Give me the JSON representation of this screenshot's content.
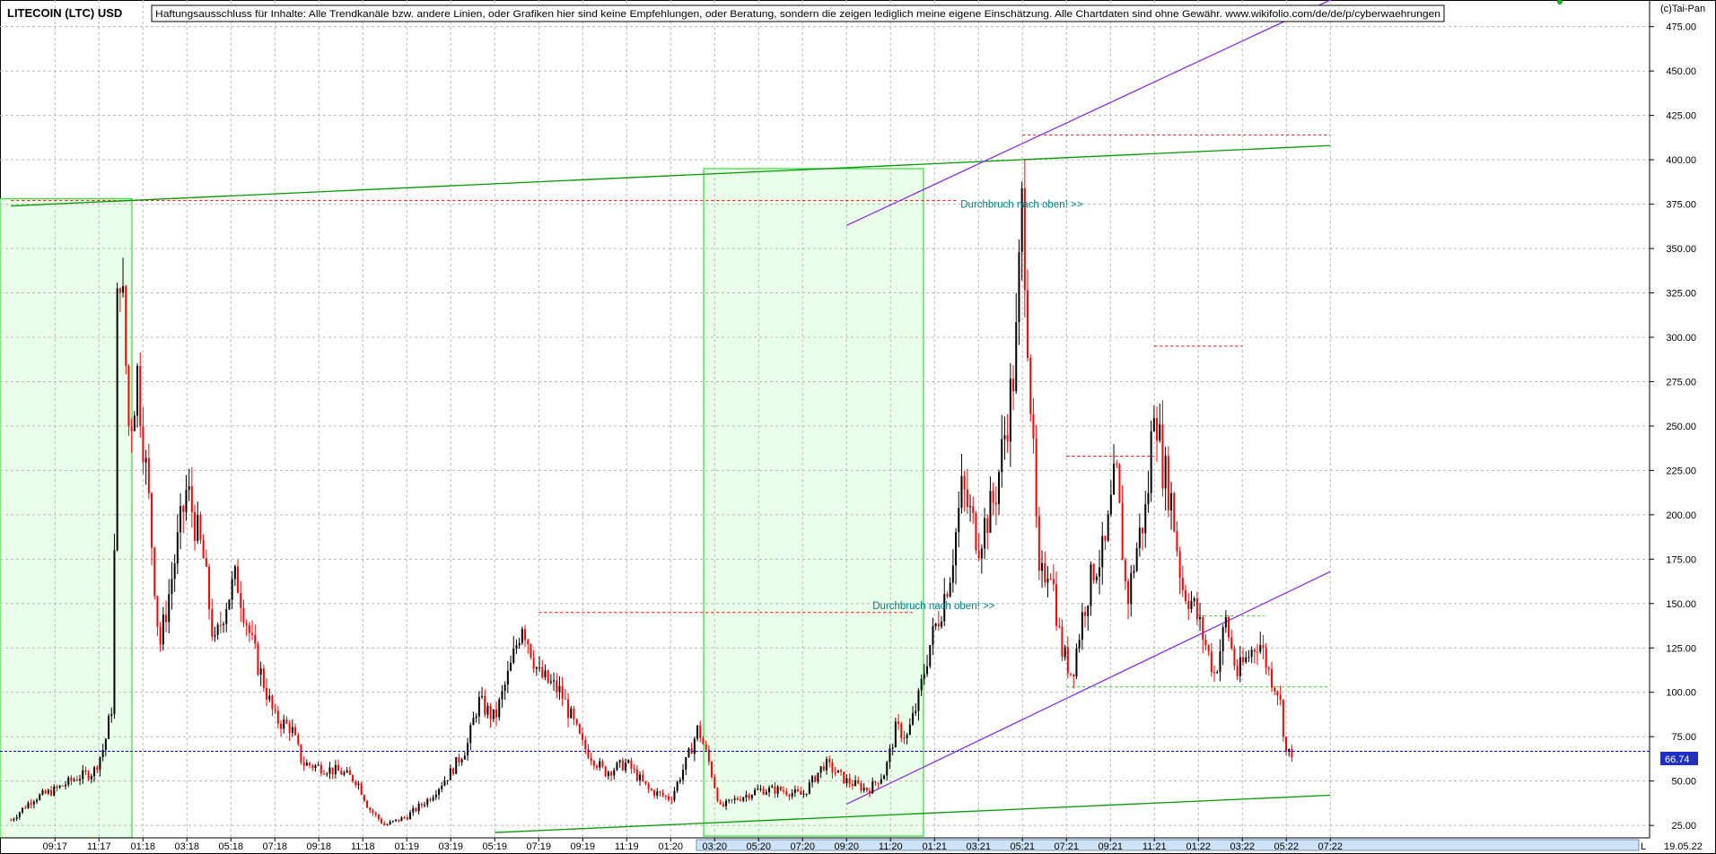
{
  "header": {
    "title": "LITECOIN (LTC) USD",
    "disclaimer": "Haftungsausschluss für Inhalte: Alle Trendkanäle bzw. andere Linien, oder Grafiken hier sind keine Empfehlungen, oder Beratung, sondern die zeigen lediglich meine eigene Einschätzung. Alle Chartdaten sind ohne Gewähr.  www.wikifolio.com/de/de/p/cyberwaehrungen",
    "copyright": "(c)Tai-Pan"
  },
  "colors": {
    "up_candle": "#000000",
    "down_candle": "#ff0000",
    "trend_green": "#009900",
    "trend_purple": "#8a2be2",
    "resistance_red": "#ff0000",
    "support_green": "#22cc22",
    "zone_fill": "#eaffea",
    "zone_border": "#33dd33",
    "last_price_line": "#0000cc",
    "annotation": "#008080"
  },
  "chart_data": {
    "type": "candlestick",
    "title": "LITECOIN (LTC) USD",
    "y_axis": {
      "ticks": [
        25,
        50,
        75,
        100,
        125,
        150,
        175,
        200,
        225,
        250,
        275,
        300,
        325,
        350,
        375,
        400,
        425,
        450,
        475
      ],
      "ylim": [
        18,
        490
      ],
      "position": "right"
    },
    "x_axis": {
      "ticks": [
        "09:17",
        "11:17",
        "01:18",
        "03:18",
        "05:18",
        "07:18",
        "09:18",
        "11:18",
        "01:19",
        "03:19",
        "05:19",
        "07:19",
        "09:19",
        "11:19",
        "01:20",
        "03:20",
        "05:20",
        "07:20",
        "09:20",
        "11:20",
        "01:21",
        "03:21",
        "05:21",
        "07:21",
        "09:21",
        "11:21",
        "01:22",
        "03:22",
        "05:22",
        "07:22"
      ],
      "end_label": "19.05.22",
      "scale_letter": "L"
    },
    "grid": true,
    "last_price": {
      "value": 66.74,
      "label": "66.74"
    },
    "price_path": [
      [
        "07:17",
        28
      ],
      [
        "08:17",
        40
      ],
      [
        "09:17",
        45
      ],
      [
        "10:17",
        52
      ],
      [
        "11:17",
        55
      ],
      [
        "11:17",
        70
      ],
      [
        "12:17",
        95
      ],
      [
        "12:17",
        360
      ],
      [
        "12:17",
        310
      ],
      [
        "12:17",
        245
      ],
      [
        "01:18",
        280
      ],
      [
        "01:18",
        210
      ],
      [
        "02:18",
        125
      ],
      [
        "02:18",
        160
      ],
      [
        "03:18",
        215
      ],
      [
        "04:18",
        175
      ],
      [
        "04:18",
        125
      ],
      [
        "05:18",
        150
      ],
      [
        "05:18",
        165
      ],
      [
        "06:18",
        125
      ],
      [
        "07:18",
        85
      ],
      [
        "08:18",
        80
      ],
      [
        "08:18",
        60
      ],
      [
        "09:18",
        58
      ],
      [
        "10:18",
        55
      ],
      [
        "11:18",
        50
      ],
      [
        "11:18",
        35
      ],
      [
        "12:18",
        25
      ],
      [
        "01:19",
        30
      ],
      [
        "02:19",
        40
      ],
      [
        "03:19",
        55
      ],
      [
        "04:19",
        70
      ],
      [
        "04:19",
        95
      ],
      [
        "05:19",
        85
      ],
      [
        "06:19",
        115
      ],
      [
        "06:19",
        140
      ],
      [
        "07:19",
        110
      ],
      [
        "08:19",
        100
      ],
      [
        "09:19",
        70
      ],
      [
        "10:19",
        55
      ],
      [
        "11:19",
        60
      ],
      [
        "12:19",
        45
      ],
      [
        "01:20",
        40
      ],
      [
        "02:20",
        62
      ],
      [
        "02:20",
        80
      ],
      [
        "03:20",
        60
      ],
      [
        "03:20",
        35
      ],
      [
        "04:20",
        40
      ],
      [
        "05:20",
        45
      ],
      [
        "06:20",
        45
      ],
      [
        "07:20",
        42
      ],
      [
        "08:20",
        60
      ],
      [
        "09:20",
        50
      ],
      [
        "10:20",
        45
      ],
      [
        "11:20",
        55
      ],
      [
        "11:20",
        80
      ],
      [
        "12:20",
        75
      ],
      [
        "12:20",
        95
      ],
      [
        "01:21",
        125
      ],
      [
        "01:21",
        145
      ],
      [
        "02:21",
        170
      ],
      [
        "02:21",
        215
      ],
      [
        "03:21",
        185
      ],
      [
        "04:21",
        210
      ],
      [
        "04:21",
        250
      ],
      [
        "05:21",
        285
      ],
      [
        "05:21",
        380
      ],
      [
        "05:21",
        275
      ],
      [
        "06:21",
        160
      ],
      [
        "06:21",
        175
      ],
      [
        "07:21",
        125
      ],
      [
        "07:21",
        110
      ],
      [
        "08:21",
        145
      ],
      [
        "08:21",
        170
      ],
      [
        "09:21",
        180
      ],
      [
        "09:21",
        225
      ],
      [
        "10:21",
        150
      ],
      [
        "10:21",
        185
      ],
      [
        "11:21",
        205
      ],
      [
        "11:21",
        270
      ],
      [
        "11:21",
        230
      ],
      [
        "12:21",
        210
      ],
      [
        "12:21",
        160
      ],
      [
        "01:22",
        150
      ],
      [
        "01:22",
        130
      ],
      [
        "02:22",
        110
      ],
      [
        "02:22",
        140
      ],
      [
        "03:22",
        110
      ],
      [
        "03:22",
        120
      ],
      [
        "04:22",
        130
      ],
      [
        "04:22",
        110
      ],
      [
        "05:22",
        100
      ],
      [
        "05:22",
        65
      ],
      [
        "05:22",
        66.74
      ]
    ],
    "annotations": [
      {
        "text": "Durchbruch nach oben! >>",
        "x": "03:21",
        "y": 375
      },
      {
        "text": "Durchbruch nach oben! >>",
        "x": "11:20",
        "y": 149
      }
    ],
    "trendlines": [
      {
        "kind": "green",
        "from": [
          "07:17",
          374
        ],
        "to": [
          "07:22",
          408
        ]
      },
      {
        "kind": "green",
        "from": [
          "05:19",
          21
        ],
        "to": [
          "07:22",
          42
        ]
      },
      {
        "kind": "purple",
        "from": [
          "09:20",
          363
        ],
        "to": [
          "07:22",
          490
        ]
      },
      {
        "kind": "purple",
        "from": [
          "09:20",
          37
        ],
        "to": [
          "07:22",
          168
        ]
      }
    ],
    "horizontal_levels": [
      {
        "kind": "red",
        "value": 377,
        "from": "07:17",
        "to": "02:21"
      },
      {
        "kind": "red",
        "value": 145,
        "from": "07:19",
        "to": "12:20"
      },
      {
        "kind": "red",
        "value": 414,
        "from": "05:21",
        "to": "07:22"
      },
      {
        "kind": "red",
        "value": 295,
        "from": "11:21",
        "to": "03:22"
      },
      {
        "kind": "red",
        "value": 233,
        "from": "07:21",
        "to": "11:21"
      },
      {
        "kind": "green",
        "value": 103,
        "from": "07:21",
        "to": "07:22"
      },
      {
        "kind": "green",
        "value": 143,
        "from": "01:22",
        "to": "04:22"
      }
    ],
    "zones": [
      {
        "from": "07:17",
        "to": "12:17",
        "low": 18,
        "high": 378
      },
      {
        "from": "03:20",
        "to": "12:20",
        "low": 19,
        "high": 395
      }
    ]
  }
}
